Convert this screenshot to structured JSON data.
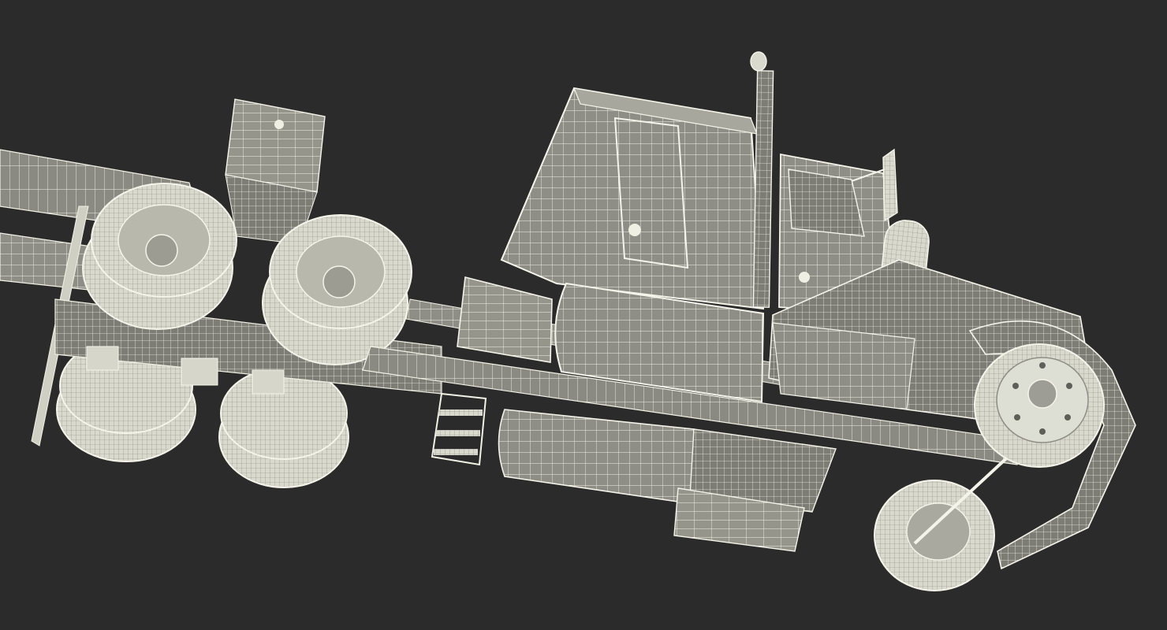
{
  "scene": {
    "background": "#2b2b2b",
    "model_fill": "#8c8c84",
    "model_fill_light": "#a4a49b",
    "model_fill_dark": "#6f6f68",
    "wire_color": "#f4f4ea",
    "wire_dark": "#3c3c38",
    "tire_fill": "#e6e6dc"
  }
}
